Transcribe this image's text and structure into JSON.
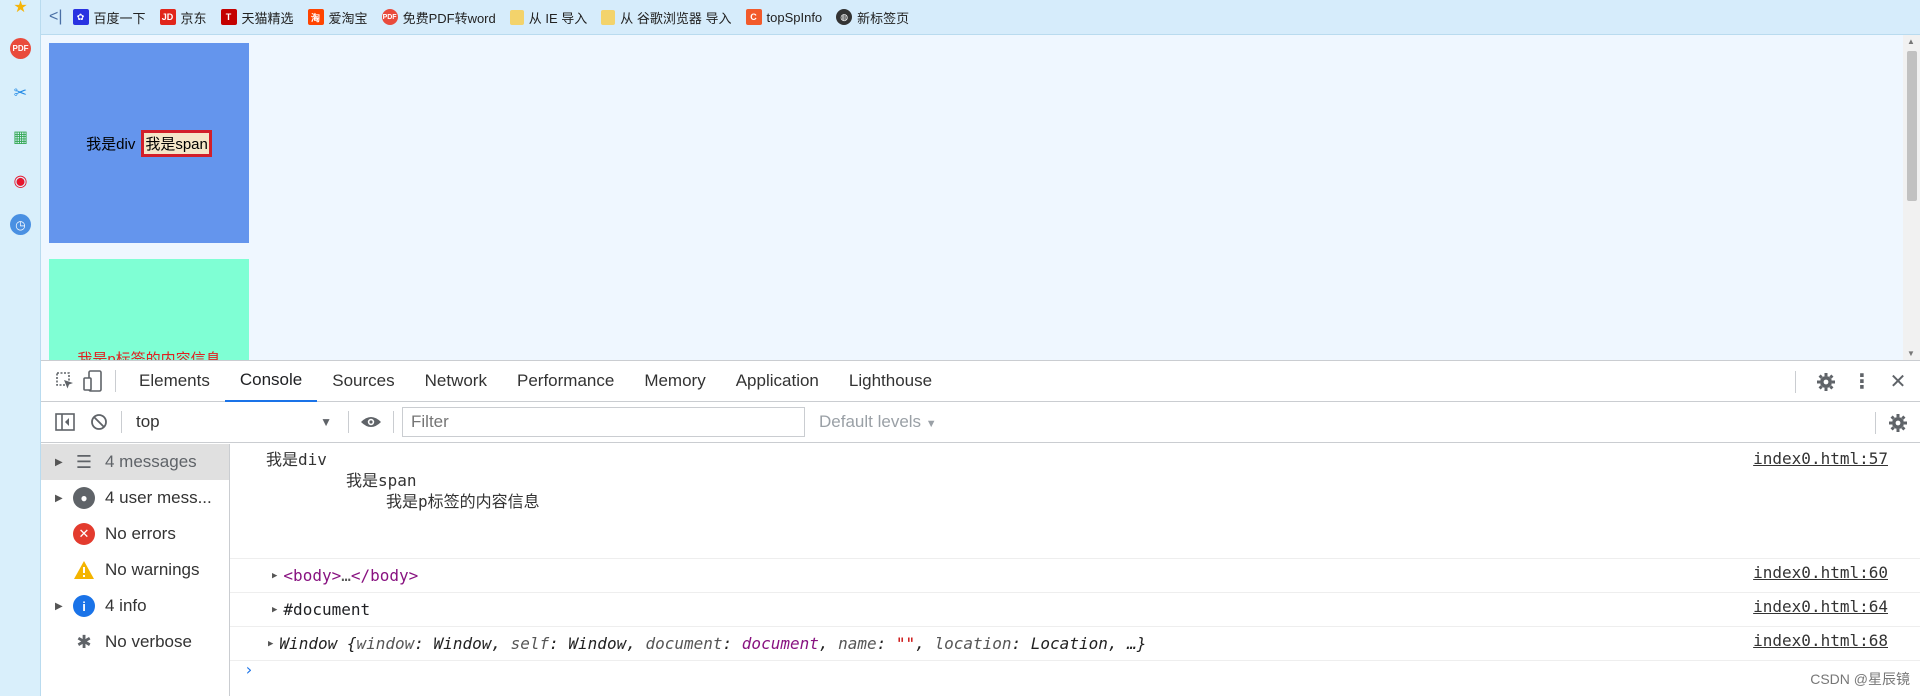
{
  "bookmarks": {
    "items": [
      {
        "label": "百度一下",
        "icon": "baidu-paw-icon",
        "color": "#2932e1"
      },
      {
        "label": "京东",
        "icon": "jd-icon",
        "color": "#e1251b"
      },
      {
        "label": "天猫精选",
        "icon": "tmall-icon",
        "color": "#c40000"
      },
      {
        "label": "爱淘宝",
        "icon": "taobao-icon",
        "color": "#ff4400"
      },
      {
        "label": "免费PDF转word",
        "icon": "pdf-icon",
        "color": "#e94b3c"
      },
      {
        "label": "从 IE 导入",
        "icon": "folder-icon",
        "color": "#f3d36b"
      },
      {
        "label": "从 谷歌浏览器 导入",
        "icon": "folder-icon",
        "color": "#f3d36b"
      },
      {
        "label": "topSpInfo",
        "icon": "topspinfo-icon",
        "color": "#f25a2a"
      },
      {
        "label": "新标签页",
        "icon": "globe-icon",
        "color": "#333333"
      }
    ]
  },
  "page": {
    "div_text": "我是div",
    "span_text": "我是span",
    "p_text": "我是p标签的内容信息"
  },
  "devtools": {
    "tabs": [
      "Elements",
      "Console",
      "Sources",
      "Network",
      "Performance",
      "Memory",
      "Application",
      "Lighthouse"
    ],
    "active_tab": "Console",
    "context": "top",
    "filter_placeholder": "Filter",
    "levels_label": "Default levels",
    "sidebar": [
      {
        "label": "4 messages",
        "icon": "list-icon",
        "expandable": true,
        "selected": true
      },
      {
        "label": "4 user mess...",
        "icon": "user-icon",
        "expandable": true,
        "selected": false
      },
      {
        "label": "No errors",
        "icon": "error-icon",
        "expandable": false,
        "selected": false
      },
      {
        "label": "No warnings",
        "icon": "warning-icon",
        "expandable": false,
        "selected": false
      },
      {
        "label": "4 info",
        "icon": "info-icon",
        "expandable": true,
        "selected": false
      },
      {
        "label": "No verbose",
        "icon": "bug-icon",
        "expandable": false,
        "selected": false
      }
    ],
    "logs": {
      "group": {
        "line1": "我是div",
        "line2": "我是span",
        "line3": "我是p标签的内容信息",
        "source": "index0.html:57"
      },
      "body": {
        "open": "<body>",
        "ellipsis": "…",
        "close": "</body>",
        "source": "index0.html:60"
      },
      "document": {
        "text": "#document",
        "source": "index0.html:64"
      },
      "window": {
        "text_parts": [
          "Window {",
          "window",
          ": Window, ",
          "self",
          ": Window, ",
          "document",
          ": ",
          "document",
          ", ",
          "name",
          ": ",
          "\"\"",
          ", ",
          "location",
          ": Location, …}"
        ],
        "source": "index0.html:68"
      }
    }
  },
  "watermark": "CSDN @星辰镜"
}
